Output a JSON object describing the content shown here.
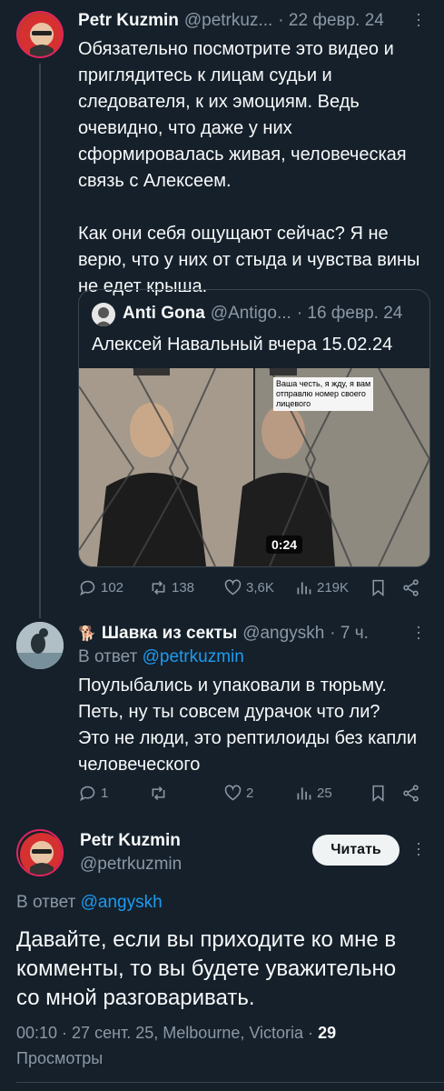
{
  "tweet1": {
    "name": "Petr Kuzmin",
    "handle": "@petrkuz...",
    "date": "· 22 февр. 24",
    "text": "Обязательно посмотрите это видео и\nприглядитесь к лицам судьи и\nследователя, к их эмоциям. Ведь\nочевидно, что даже у них\nсформировалась живая, человеческая\nсвязь с Алексеем.\n\nКак они себя ощущают сейчас? Я не\nверю, что у них от стыда и чувства вины\nне едет крыша.",
    "avatar_text": "РОССИЯ БЕЗ ПУТИНА",
    "quote": {
      "name": "Anti Gona",
      "handle": "@Antigo...",
      "date": "· 16 февр. 24",
      "text": "Алексей Навальный вчера 15.02.24",
      "caption": "Ваша честь, я жду, я вам\nотправлю номер своего\nлицевого",
      "duration": "0:24"
    },
    "stats": {
      "replies": "102",
      "retweets": "138",
      "likes": "3,6K",
      "views": "219K"
    }
  },
  "tweet2": {
    "emoji": "🐕",
    "name": "Шавка из секты",
    "handle": "@angyskh",
    "date": "· 7 ч.",
    "reply_prefix": "В ответ",
    "reply_to": "@petrkuzmin",
    "text": "Поулыбались и упаковали в тюрьму.\nПеть, ну ты совсем дурачок что ли?\nЭто не люди, это рептилоиды без капли\nчеловеческого",
    "stats": {
      "replies": "1",
      "retweets": "",
      "likes": "2",
      "views": "25"
    }
  },
  "main": {
    "name": "Petr Kuzmin",
    "handle": "@petrkuzmin",
    "follow_label": "Читать",
    "reply_prefix": "В ответ",
    "reply_to": "@angyskh",
    "text": "Давайте, если вы приходите ко мне в\nкомменты, то вы будете уважительно\nсо мной разговаривать.",
    "meta": "00:10 · 27 сент. 25, Melbourne, Victoria ·",
    "views_count": "29",
    "views_label": "Просмотры"
  },
  "colors": {
    "background": "#15202b",
    "accent": "#1d9bf0",
    "muted": "#8b98a5",
    "border": "#38444d",
    "avatar_ring": "#e0245e"
  },
  "icons": [
    "reply-icon",
    "retweet-icon",
    "like-icon",
    "views-icon",
    "bookmark-icon",
    "share-icon",
    "more-icon",
    "play-icon"
  ]
}
